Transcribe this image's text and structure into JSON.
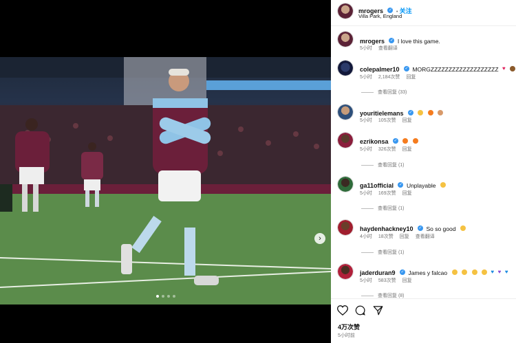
{
  "post": {
    "username": "mrogers",
    "follow_label": "关注",
    "location": "Villa Park, England",
    "caption_user": "mrogers",
    "caption_text": "I love this game.",
    "caption_time": "5小时",
    "caption_translate": "查看翻译",
    "like_count": "4万次赞",
    "post_time": "5小时前"
  },
  "media": {
    "next_icon": "chevron-right-icon",
    "dots_total": 4,
    "active_dot": 1
  },
  "comments": [
    {
      "user": "colepalmer10",
      "text": "MORGZZZZZZZZZZZZZZZZZZZ",
      "emojis": [
        "red-heart",
        "bear-face"
      ],
      "time": "5小时",
      "likes": "2,184次赞",
      "reply": "回复",
      "replies": "查看回复 (33)"
    },
    {
      "user": "youritielemans",
      "text": "",
      "emojis": [
        "smiling-face-with-halo",
        "fire",
        "flexed-biceps"
      ],
      "time": "5小时",
      "likes": "105次赞",
      "reply": "回复",
      "replies": ""
    },
    {
      "user": "ezrikonsa",
      "text": "",
      "emojis": [
        "fire",
        "fire"
      ],
      "time": "5小时",
      "likes": "326次赞",
      "reply": "回复",
      "replies": "查看回复 (1)"
    },
    {
      "user": "ga11official",
      "text": "Unplayable",
      "emojis": [
        "raising-hands"
      ],
      "time": "5小时",
      "likes": "169次赞",
      "reply": "回复",
      "replies": "查看回复 (1)"
    },
    {
      "user": "haydenhackney10",
      "text": "So so good",
      "emojis": [
        "clapping-hands"
      ],
      "time": "4小时",
      "likes": "18次赞",
      "reply": "回复",
      "translate": "查看翻译",
      "replies": "查看回复 (1)"
    },
    {
      "user": "jaderduran9",
      "text": "James y falcao",
      "emojis": [
        "heart-eyes",
        "heart-eyes",
        "heart-eyes",
        "heart-eyes",
        "blue-heart",
        "purple-heart",
        "blue-heart"
      ],
      "time": "5小时",
      "likes": "583次赞",
      "reply": "回复",
      "replies": "查看回复 (8)"
    }
  ],
  "colors": {
    "accent": "#0095f6",
    "verified": "#3897f0",
    "muted": "#737373",
    "claret": "#670e36"
  },
  "icons": {
    "like": "heart-outline-icon",
    "comment": "comment-bubble-icon",
    "share": "paper-plane-icon"
  }
}
